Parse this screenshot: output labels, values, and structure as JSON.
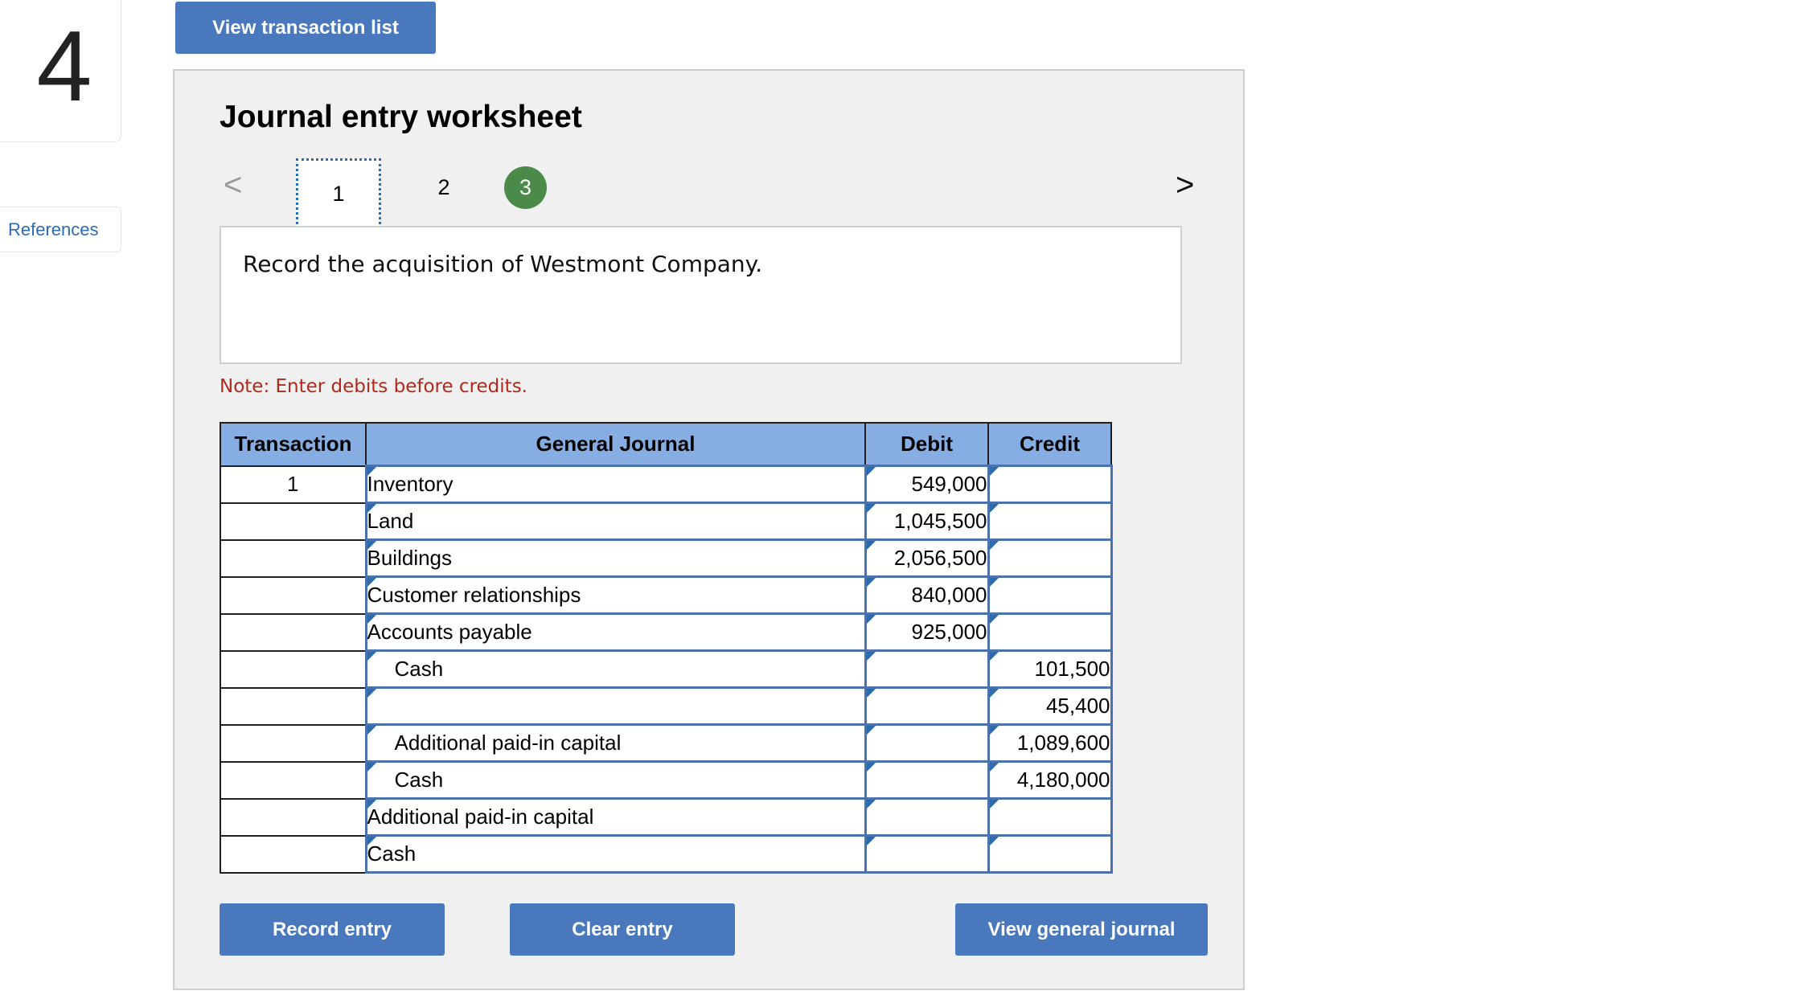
{
  "question": {
    "number": "4"
  },
  "sidebar": {
    "references_label": "References"
  },
  "top": {
    "view_transactions_label": "View transaction list"
  },
  "worksheet": {
    "title": "Journal entry worksheet",
    "nav": {
      "prev": "<",
      "next": ">"
    },
    "pages": [
      "1",
      "2",
      "3"
    ],
    "selected_page": "1",
    "instruction": "Record the acquisition of Westmont Company.",
    "note": "Note: Enter debits before credits."
  },
  "table": {
    "headers": {
      "transaction": "Transaction",
      "general_journal": "General Journal",
      "debit": "Debit",
      "credit": "Credit"
    },
    "rows": [
      {
        "tx": "1",
        "account": "Inventory",
        "debit": "549,000",
        "credit": ""
      },
      {
        "tx": "",
        "account": "Land",
        "debit": "1,045,500",
        "credit": ""
      },
      {
        "tx": "",
        "account": "Buildings",
        "debit": "2,056,500",
        "credit": ""
      },
      {
        "tx": "",
        "account": "Customer relationships",
        "debit": "840,000",
        "credit": ""
      },
      {
        "tx": "",
        "account": "Accounts payable",
        "debit": "925,000",
        "credit": ""
      },
      {
        "tx": "",
        "account": "Cash",
        "debit": "",
        "credit": "101,500"
      },
      {
        "tx": "",
        "account": "",
        "debit": "",
        "credit": "45,400"
      },
      {
        "tx": "",
        "account": "Additional paid-in capital",
        "debit": "",
        "credit": "1,089,600"
      },
      {
        "tx": "",
        "account": "Cash",
        "debit": "",
        "credit": "4,180,000"
      },
      {
        "tx": "",
        "account": "Additional paid-in capital",
        "debit": "",
        "credit": ""
      },
      {
        "tx": "",
        "account": "Cash",
        "debit": "",
        "credit": ""
      }
    ]
  },
  "buttons": {
    "record_entry": "Record entry",
    "clear_entry": "Clear entry",
    "view_general_journal": "View general journal"
  }
}
